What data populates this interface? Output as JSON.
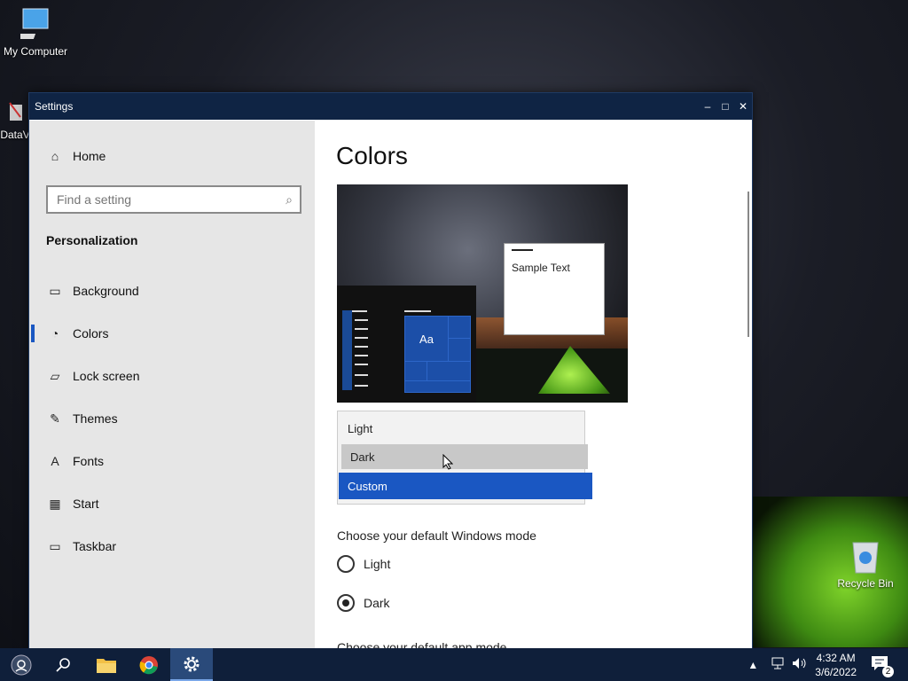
{
  "desktop": {
    "my_computer": "My Computer",
    "data_icon": "DataV",
    "recycle_bin": "Recycle Bin"
  },
  "window": {
    "title": "Settings",
    "controls": {
      "minimize": "–",
      "maximize": "□",
      "close": "✕"
    }
  },
  "sidebar": {
    "home": "Home",
    "search_placeholder": "Find a setting",
    "section": "Personalization",
    "items": [
      {
        "label": "Background",
        "icon": "image-icon",
        "glyph": "▭",
        "active": false
      },
      {
        "label": "Colors",
        "icon": "palette-icon",
        "glyph": "◔",
        "active": true
      },
      {
        "label": "Lock screen",
        "icon": "lock-screen-icon",
        "glyph": "▱",
        "active": false
      },
      {
        "label": "Themes",
        "icon": "themes-icon",
        "glyph": "✎",
        "active": false
      },
      {
        "label": "Fonts",
        "icon": "fonts-icon",
        "glyph": "A",
        "active": false
      },
      {
        "label": "Start",
        "icon": "start-icon",
        "glyph": "▦",
        "active": false
      },
      {
        "label": "Taskbar",
        "icon": "taskbar-icon",
        "glyph": "▭",
        "active": false
      }
    ]
  },
  "main": {
    "title": "Colors",
    "preview": {
      "tile_text": "Aa",
      "sample_text": "Sample Text"
    },
    "dropdown": {
      "options": [
        "Light",
        "Dark",
        "Custom"
      ],
      "hovered": "Dark",
      "selected": "Custom"
    },
    "windows_mode": {
      "label": "Choose your default Windows mode",
      "options": [
        "Light",
        "Dark"
      ],
      "selected": "Dark"
    },
    "app_mode_label": "Choose your default app mode"
  },
  "taskbar": {
    "time": "4:32 AM",
    "date": "3/6/2022",
    "notification_count": "2"
  },
  "colors": {
    "accent": "#1a57c2",
    "titlebar": "#0f2444",
    "taskbar": "#0f1f3a"
  }
}
